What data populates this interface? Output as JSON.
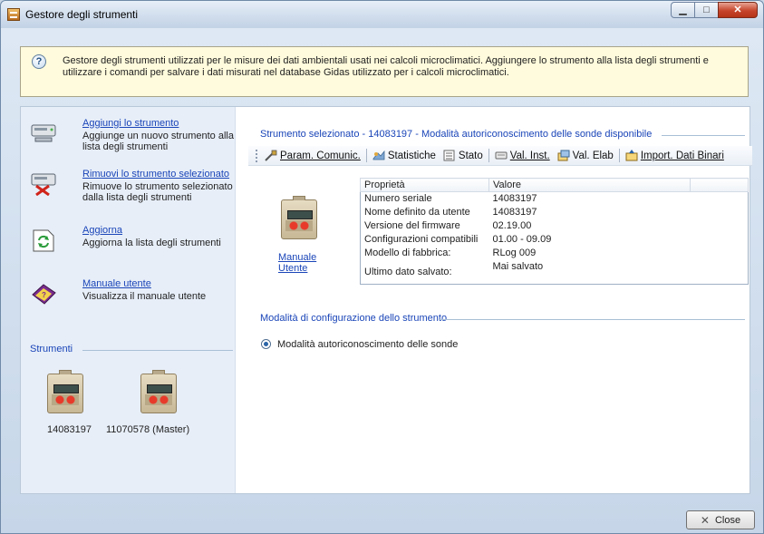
{
  "window": {
    "title": "Gestore degli strumenti",
    "controls": {
      "minimize": "▁",
      "maximize": "□",
      "close": "✕"
    }
  },
  "info": {
    "icon": "help-icon",
    "text": "Gestore degli strumenti utilizzati per le misure dei dati ambientali usati nei calcoli microclimatici. Aggiungere lo strumento alla lista degli strumenti e utilizzare i comandi per salvare i dati misurati nel database Gidas utilizzato per i calcoli microclimatici."
  },
  "actions": [
    {
      "link": "Aggiungi lo strumento",
      "desc": "Aggiunge un nuovo strumento alla lista degli strumenti",
      "icon": "add-device-icon"
    },
    {
      "link": "Rimuovi lo strumento selezionato",
      "desc": "Rimuove lo strumento selezionato dalla lista degli strumenti",
      "icon": "remove-device-icon"
    },
    {
      "link": "Aggiorna",
      "desc": "Aggiorna la lista degli strumenti",
      "icon": "refresh-icon"
    },
    {
      "link": "Manuale utente",
      "desc": "Visualizza il manuale utente",
      "icon": "manual-icon"
    }
  ],
  "instruments": {
    "label": "Strumenti",
    "items": [
      "14083197",
      "11070578 (Master)"
    ]
  },
  "selected": {
    "title": "Strumento selezionato  - 14083197 - Modalità autoriconoscimento delle sonde disponibile",
    "manual_link": "Manuale Utente"
  },
  "toolbar": {
    "buttons": [
      "Param. Comunic.",
      "Statistiche",
      "Stato",
      "Val. Inst.",
      "Val. Elab",
      "Import. Dati Binari"
    ]
  },
  "properties": {
    "headers": [
      "Proprietà",
      "Valore"
    ],
    "rows": [
      [
        "Numero seriale",
        "14083197"
      ],
      [
        "Nome definito da utente",
        "14083197"
      ],
      [
        "Versione del firmware",
        "02.19.00"
      ],
      [
        "Configurazioni compatibili",
        "01.00 - 09.09"
      ],
      [
        "Modello di fabbrica:",
        "RLog 009"
      ],
      [
        "Ultimo dato salvato:",
        "Mai salvato"
      ]
    ]
  },
  "config": {
    "label": "Modalità di configurazione dello strumento",
    "option": "Modalità autoriconoscimento delle sonde"
  },
  "close_button": "Close",
  "colors": {
    "link": "#1a45b8",
    "info_bg": "#fffbdc",
    "close_red": "#c6452b"
  }
}
